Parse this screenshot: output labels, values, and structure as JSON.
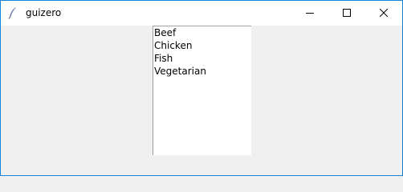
{
  "window": {
    "title": "guizero",
    "app_icon": "feather-icon",
    "controls": [
      "minimize-icon",
      "maximize-icon",
      "close-icon"
    ]
  },
  "listbox": {
    "items": [
      "Beef",
      "Chicken",
      "Fish",
      "Vegetarian"
    ]
  },
  "colors": {
    "titlebar": "#ffffff",
    "client": "#f0f0f0",
    "window_border": "#1883d7",
    "listbox_bg": "#ffffff",
    "listbox_border": "#a0a0a0"
  }
}
